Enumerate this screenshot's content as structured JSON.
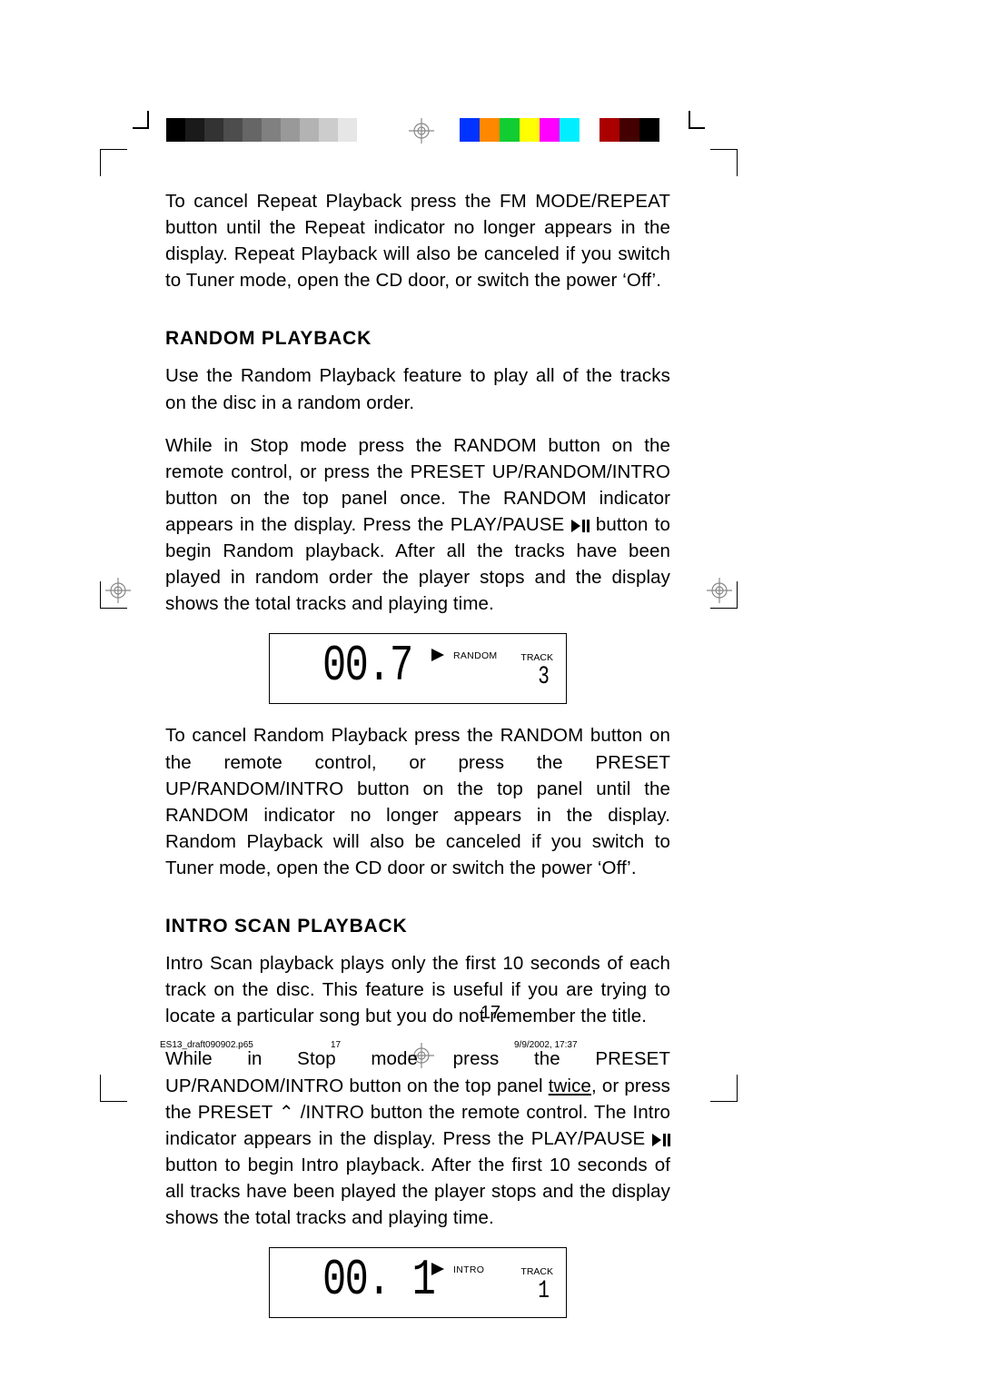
{
  "body": {
    "para_cancel_repeat": "To cancel Repeat Playback press the FM MODE/REPEAT button until the Repeat indicator no longer appears in the display. Repeat Playback will also be canceled if you switch to Tuner mode, open the CD door, or switch the power ‘Off’.",
    "heading_random": "RANDOM PLAYBACK",
    "para_random_intro": "Use the Random Playback feature to play all of the tracks on the disc in a random order.",
    "para_random_main_a": "While in Stop mode press the RANDOM button on the remote control, or press the PRESET UP/RANDOM/INTRO button on the top panel once. The RANDOM indicator appears in the display. Press the PLAY/PAUSE ",
    "para_random_main_b": " button to begin Random playback. After all the tracks have been played in random order the player stops and the display shows the total tracks and playing time.",
    "para_random_cancel": "To cancel Random Playback press the RANDOM button on the remote control, or press the PRESET UP/RANDOM/INTRO button on the top panel until the RANDOM indicator no longer appears in the display. Random Playback will also be canceled if you switch to Tuner mode, open the CD door or switch the power ‘Off’.",
    "heading_intro": "INTRO SCAN PLAYBACK",
    "para_intro_desc": "Intro Scan playback plays only the first 10 seconds of each track on the disc. This feature is useful if you are trying to locate a particular song but you do not remember the title.",
    "para_intro_main_a": "While in Stop mode press the PRESET UP/RANDOM/INTRO button on the top panel ",
    "twice": "twice",
    "para_intro_main_b": ", or press the PRESET ",
    "para_intro_main_c": " /INTRO button the remote control. The Intro indicator appears in the display. Press the PLAY/PAUSE ",
    "para_intro_main_d": " button to begin Intro playback. After the first 10 seconds of all tracks have been played the player stops and the display shows the total tracks and playing time."
  },
  "lcd1": {
    "time": "00.7",
    "mode": "RANDOM",
    "track_label": "TRACK",
    "track": "3"
  },
  "lcd2": {
    "time": "00. 1",
    "mode": "INTRO",
    "track_label": "TRACK",
    "track": "1"
  },
  "page_number": "17",
  "footer": {
    "file": "ES13_draft090902.p65",
    "pg": "17",
    "dt": "9/9/2002, 17:37"
  },
  "color_bands": [
    "#0033ff",
    "#ff8800",
    "#11cc33",
    "#ffff00",
    "#ff00ff",
    "#00eeff",
    "#ffffff",
    "#aa0000",
    "#440000",
    "#000000"
  ],
  "gray_bands": [
    "#000000",
    "#1a1a1a",
    "#333333",
    "#4d4d4d",
    "#666666",
    "#808080",
    "#999999",
    "#b3b3b3",
    "#cccccc",
    "#e6e6e6",
    "#ffffff"
  ]
}
